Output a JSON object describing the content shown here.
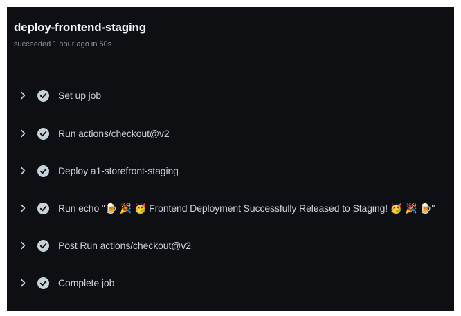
{
  "job": {
    "title": "deploy-frontend-staging",
    "subtitle": "succeeded 1 hour ago in 50s"
  },
  "steps": [
    {
      "label": "Set up job",
      "status": "success"
    },
    {
      "label": "Run actions/checkout@v2",
      "status": "success"
    },
    {
      "label": "Deploy a1-storefront-staging",
      "status": "success"
    },
    {
      "label": "Run echo \"🍺 🎉 🥳 Frontend Deployment Successfully Released to Staging! 🥳 🎉 🍺\"",
      "status": "success"
    },
    {
      "label": "Post Run actions/checkout@v2",
      "status": "success"
    },
    {
      "label": "Complete job",
      "status": "success"
    }
  ],
  "icons": {
    "expand": "chevron-right-icon",
    "status": "check-circle-icon"
  },
  "colors": {
    "background": "#0d0f12",
    "check_fill": "#8b949e"
  }
}
